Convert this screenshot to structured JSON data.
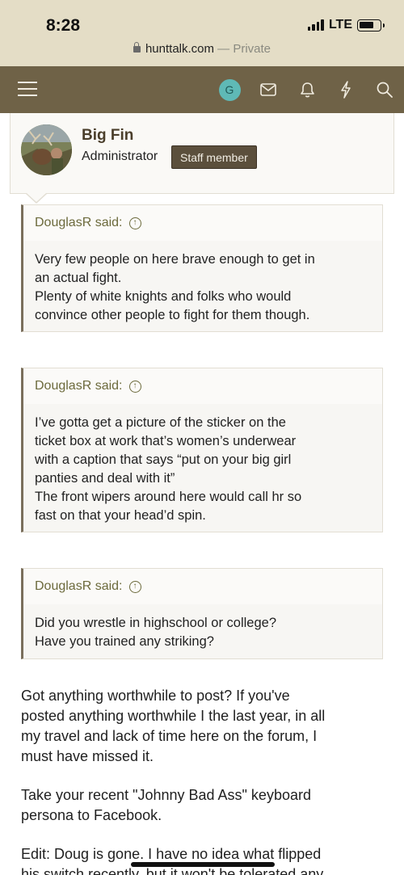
{
  "status_bar": {
    "time": "8:28",
    "network": "LTE"
  },
  "browser": {
    "domain": "hunttalk.com",
    "separator": " — ",
    "mode": "Private"
  },
  "nav": {
    "avatar_letter": "G",
    "icons": [
      "menu-icon",
      "mail-icon",
      "bell-icon",
      "lightning-icon",
      "search-icon"
    ],
    "bar_color": "#6f6247"
  },
  "member": {
    "name": "Big Fin",
    "role": "Administrator",
    "badge": "Staff member"
  },
  "quotes": [
    {
      "author_line": "DouglasR said:",
      "lines": [
        "Very few people on here brave enough to get in",
        "an actual fight.",
        "Plenty of white knights and folks who would",
        "convince other people to fight for them though."
      ]
    },
    {
      "author_line": "DouglasR said:",
      "lines": [
        "I’ve gotta get a picture of the sticker on the",
        "ticket box at work that’s women’s underwear",
        "with a caption that says “put on your big girl",
        "panties and deal with it”",
        "The front wipers around here would call hr so",
        "fast on that your head’d spin."
      ]
    },
    {
      "author_line": "DouglasR said:",
      "lines": [
        "Did you wrestle in highschool or college?",
        "Have you trained any striking?"
      ]
    }
  ],
  "post": {
    "paragraphs": [
      [
        "Got anything worthwhile to post? If you've",
        "posted anything worthwhile I the last year, in all",
        "my travel and lack of time here on the forum, I",
        "must have missed it."
      ],
      [
        "Take your recent \"Johnny Bad Ass\" keyboard",
        "persona to Facebook."
      ],
      [
        "Edit: Doug is gone. I have no idea what flipped",
        "his switch recently, but it won't be tolerated any"
      ]
    ]
  }
}
